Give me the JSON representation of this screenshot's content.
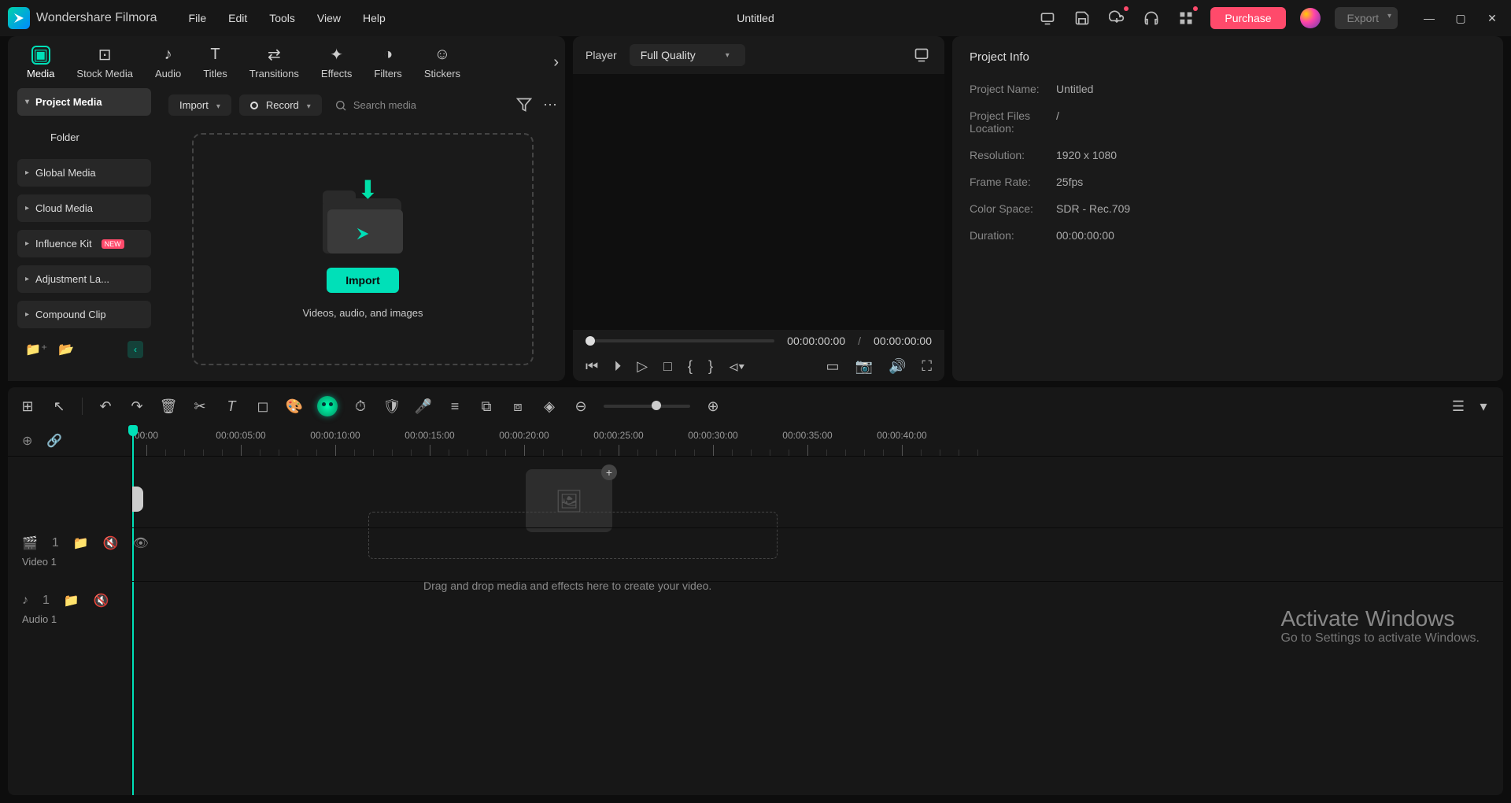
{
  "app": {
    "name": "Wondershare Filmora",
    "doc_title": "Untitled"
  },
  "menus": [
    "File",
    "Edit",
    "Tools",
    "View",
    "Help"
  ],
  "titlebar_buttons": {
    "purchase": "Purchase",
    "export": "Export"
  },
  "tabs": [
    {
      "label": "Media",
      "active": true
    },
    {
      "label": "Stock Media"
    },
    {
      "label": "Audio"
    },
    {
      "label": "Titles"
    },
    {
      "label": "Transitions"
    },
    {
      "label": "Effects"
    },
    {
      "label": "Filters"
    },
    {
      "label": "Stickers"
    }
  ],
  "media_tree": {
    "project_media": "Project Media",
    "folder": "Folder",
    "global_media": "Global Media",
    "cloud_media": "Cloud Media",
    "influence_kit": "Influence Kit",
    "influence_badge": "NEW",
    "adjustment_layer": "Adjustment La...",
    "compound_clip": "Compound Clip"
  },
  "media_topbar": {
    "import": "Import",
    "record": "Record",
    "search_placeholder": "Search media"
  },
  "drop_zone": {
    "button": "Import",
    "hint": "Videos, audio, and images"
  },
  "player": {
    "label": "Player",
    "quality": "Full Quality",
    "current": "00:00:00:00",
    "sep": "/",
    "total": "00:00:00:00"
  },
  "project_info": {
    "title": "Project Info",
    "rows": [
      {
        "k": "Project Name:",
        "v": "Untitled"
      },
      {
        "k": "Project Files Location:",
        "v": "/"
      },
      {
        "k": "Resolution:",
        "v": "1920 x 1080"
      },
      {
        "k": "Frame Rate:",
        "v": "25fps"
      },
      {
        "k": "Color Space:",
        "v": "SDR - Rec.709"
      },
      {
        "k": "Duration:",
        "v": "00:00:00:00"
      }
    ]
  },
  "timeline": {
    "marks": [
      "00:00",
      "00:00:05:00",
      "00:00:10:00",
      "00:00:15:00",
      "00:00:20:00",
      "00:00:25:00",
      "00:00:30:00",
      "00:00:35:00",
      "00:00:40:00"
    ],
    "hint": "Drag and drop media and effects here to create your video.",
    "video_track": "Video 1",
    "audio_track": "Audio 1"
  },
  "watermark": {
    "l1": "Activate Windows",
    "l2": "Go to Settings to activate Windows."
  }
}
